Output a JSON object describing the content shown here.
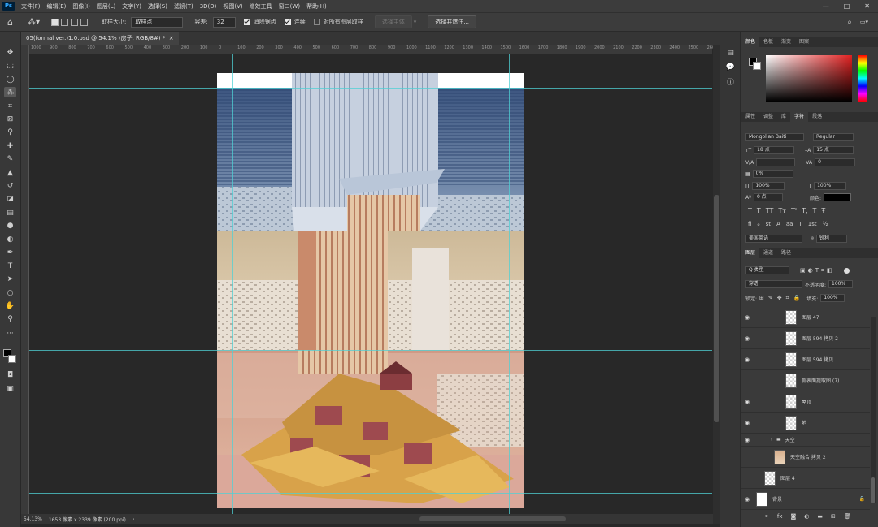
{
  "app": {
    "logo": "Ps"
  },
  "menu": [
    "文件(F)",
    "编辑(E)",
    "图像(I)",
    "图层(L)",
    "文字(Y)",
    "选择(S)",
    "滤镜(T)",
    "3D(D)",
    "视图(V)",
    "增效工具",
    "窗口(W)",
    "帮助(H)"
  ],
  "window_buttons": [
    "—",
    "□",
    "✕"
  ],
  "options": {
    "sample_size_label": "取样大小:",
    "sample_size_value": "取样点",
    "tolerance_label": "容差:",
    "tolerance_value": "32",
    "antialias": "消除锯齿",
    "contiguous": "连续",
    "sample_all": "对所有图层取样",
    "select_subject": "选择主体",
    "select_and_mask": "选择并遮住..."
  },
  "document": {
    "tab_title": "05(formal ver.)1.0.psd @ 54.1% (房子, RGB/8#) *",
    "close": "×"
  },
  "ruler_labels": [
    "1000",
    "900",
    "800",
    "700",
    "600",
    "500",
    "400",
    "300",
    "200",
    "100",
    "0",
    "100",
    "200",
    "300",
    "400",
    "500",
    "600",
    "700",
    "800",
    "900",
    "1000",
    "1100",
    "1200",
    "1300",
    "1400",
    "1500",
    "1600",
    "1700",
    "1800",
    "1900",
    "2000",
    "2100",
    "2200",
    "2300",
    "2400",
    "2500",
    "2600"
  ],
  "status": {
    "zoom": "54.13%",
    "doc_size": "1653 像素 x 2339 像素 (200 ppi)",
    "arrow": "›"
  },
  "color_panel": {
    "tabs": [
      "颜色",
      "色板",
      "渐变",
      "图案"
    ]
  },
  "char_panel": {
    "tabs": [
      "属性",
      "调整",
      "库",
      "字符",
      "段落"
    ],
    "font": "Mongolian Baiti",
    "style": "Regular",
    "size": "18 点",
    "leading": "15 点",
    "tracking": "0",
    "kerning": "",
    "vscale": "0%",
    "vert_scale": "100%",
    "horiz_scale": "100%",
    "baseline": "0 点",
    "color_label": "颜色:",
    "lang": "美国英语",
    "aa": "锐利"
  },
  "layers_panel": {
    "tabs": [
      "图层",
      "通道",
      "路径"
    ],
    "kind": "Q 类型",
    "blend": "穿透",
    "opacity_label": "不透明度:",
    "opacity": "100%",
    "lock_label": "锁定:",
    "fill_label": "填充:",
    "fill": "100%",
    "layers": [
      {
        "name": "图层 47",
        "visible": true
      },
      {
        "name": "图层 594 拷贝 2",
        "visible": true
      },
      {
        "name": "图层 594 拷贝",
        "visible": true
      },
      {
        "name": "侧表面提取图 (7)",
        "visible": false
      },
      {
        "name": "屋顶",
        "visible": true
      },
      {
        "name": "地",
        "visible": true
      },
      {
        "name": "天空",
        "visible": true,
        "group": true
      },
      {
        "name": "天空融合 拷贝 2",
        "visible": false
      },
      {
        "name": "图层 4",
        "visible": false
      },
      {
        "name": "背景",
        "visible": true,
        "locked": true
      }
    ]
  }
}
